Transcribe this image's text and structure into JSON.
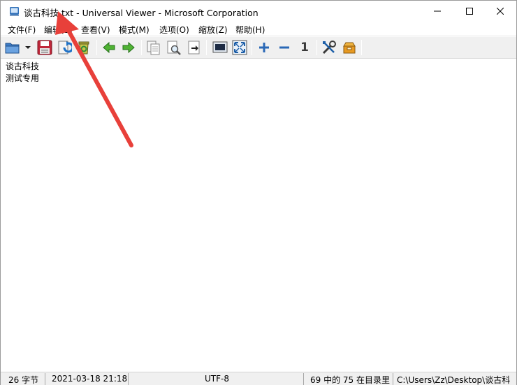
{
  "window": {
    "title": "谈古科技.txt - Universal Viewer - Microsoft Corporation",
    "app_icon": "universal-viewer-icon",
    "controls": [
      "minimize-icon",
      "maximize-icon",
      "close-icon"
    ]
  },
  "menu": {
    "items": [
      {
        "label": "文件(F)"
      },
      {
        "label": "编辑(E)"
      },
      {
        "label": "查看(V)"
      },
      {
        "label": "模式(M)"
      },
      {
        "label": "选项(O)"
      },
      {
        "label": "缩放(Z)"
      },
      {
        "label": "帮助(H)"
      }
    ]
  },
  "toolbar": {
    "buttons": [
      "open-folder-icon",
      "dropdown-arrow-icon",
      "save-icon",
      "reload-icon",
      "recycle-icon",
      "back-arrow-icon",
      "forward-arrow-icon",
      "copy-icon",
      "find-icon",
      "goto-icon",
      "fit-window-icon",
      "fullscreen-icon",
      "zoom-in-icon",
      "zoom-out-icon",
      "zoom-original-icon",
      "options-tools-icon",
      "plugins-icon"
    ],
    "zoom_original_label": "1"
  },
  "content": {
    "lines": [
      "谈古科技",
      "测试专用"
    ]
  },
  "statusbar": {
    "size": "26 字节",
    "date": "2021-03-18 21:18",
    "encoding": "UTF-8",
    "position": "69 中的 75 在目录里",
    "path": "C:\\Users\\Zz\\Desktop\\谈古科"
  },
  "annotation": {
    "arrow_color": "#e8403a"
  }
}
